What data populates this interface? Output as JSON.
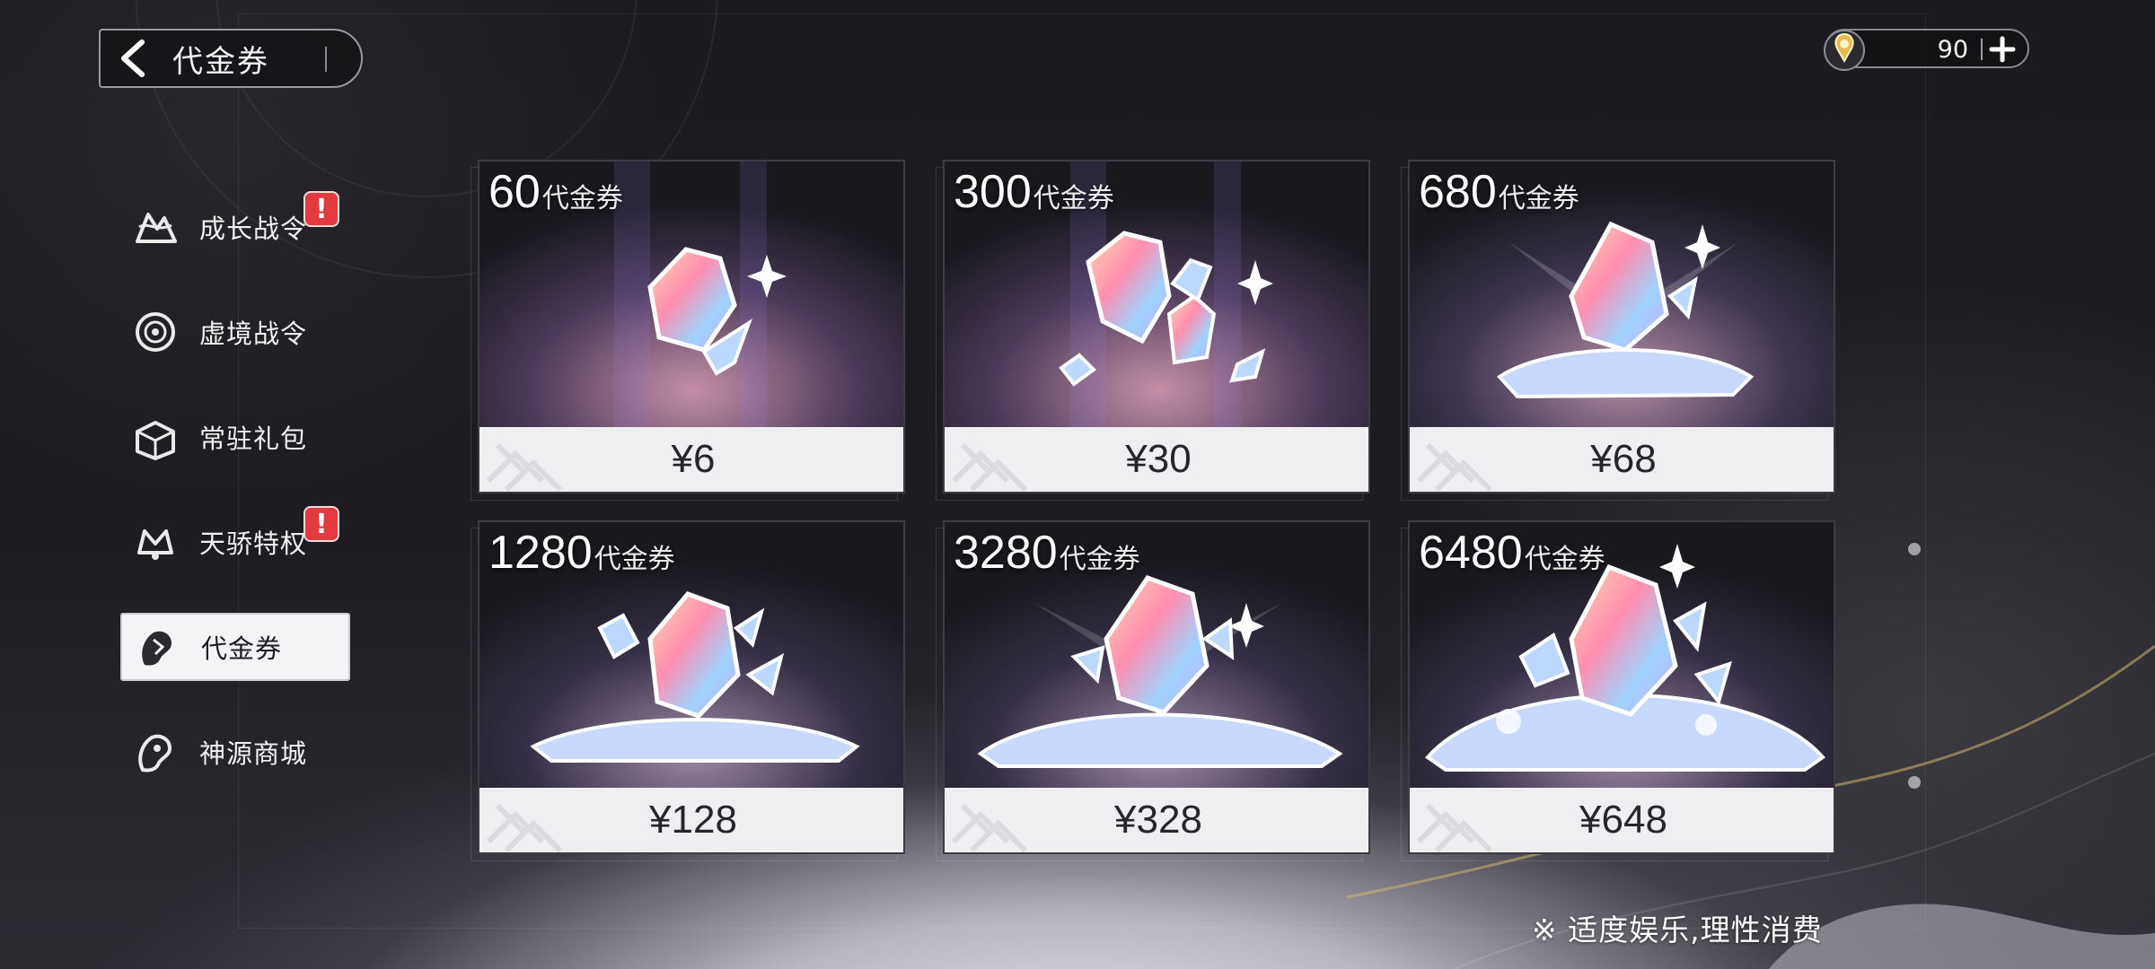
{
  "header": {
    "title": "代金券"
  },
  "currency": {
    "amount": "90"
  },
  "sidebar": {
    "items": [
      {
        "label": "成长战令",
        "icon": "growth-pass-icon",
        "badge": "!"
      },
      {
        "label": "虚境战令",
        "icon": "void-pass-icon"
      },
      {
        "label": "常驻礼包",
        "icon": "gift-pack-icon"
      },
      {
        "label": "天骄特权",
        "icon": "privilege-icon",
        "badge": "!"
      },
      {
        "label": "代金券",
        "icon": "voucher-icon",
        "active": true
      },
      {
        "label": "神源商城",
        "icon": "shop-icon"
      }
    ]
  },
  "products": [
    {
      "amount": "60",
      "unit": "代金券",
      "price": "¥6"
    },
    {
      "amount": "300",
      "unit": "代金券",
      "price": "¥30"
    },
    {
      "amount": "680",
      "unit": "代金券",
      "price": "¥68"
    },
    {
      "amount": "1280",
      "unit": "代金券",
      "price": "¥128"
    },
    {
      "amount": "3280",
      "unit": "代金券",
      "price": "¥328"
    },
    {
      "amount": "6480",
      "unit": "代金券",
      "price": "¥648"
    }
  ],
  "footer": {
    "notice": "※ 适度娱乐,理性消费"
  },
  "colors": {
    "badge": "#e23a3e",
    "price_bar": "#efeff1",
    "active_tab": "#f4f4f6"
  }
}
